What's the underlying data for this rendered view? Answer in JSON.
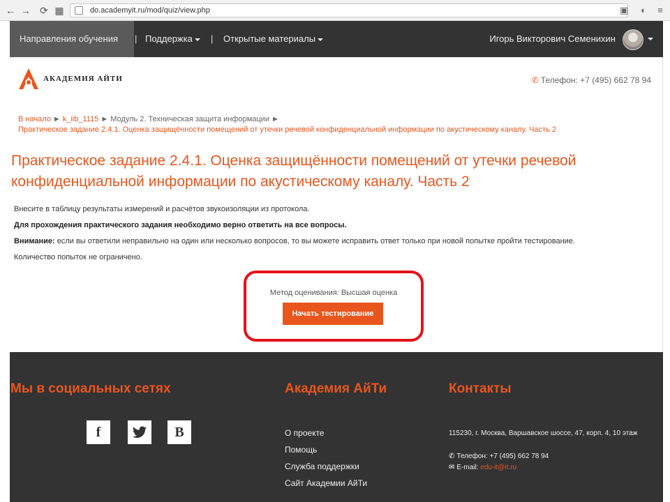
{
  "browser": {
    "url": "do.academyit.ru/mod/quiz/view.php"
  },
  "topnav": {
    "items": [
      {
        "label": "Направления обучения"
      },
      {
        "label": "Поддержка"
      },
      {
        "label": "Открытые материалы"
      }
    ],
    "separator": "|",
    "user_name": "Игорь Викторович Семенихин"
  },
  "brand": {
    "logo_text": "АКАДЕМИЯ АЙТИ",
    "phone_label": "Телефон:",
    "phone_number": "+7 (495) 662 78 94",
    "accent_color": "#e8561e"
  },
  "breadcrumb": {
    "items": [
      "В начало",
      "k_iib_1115",
      "Модуль 2. Техническая защита информации"
    ],
    "current": "Практическое задание 2.4.1. Оценка защищённости помещений от утечки речевой конфиденциальной информации по акустическому каналу. Часть 2"
  },
  "page": {
    "title": "Практическое задание 2.4.1. Оценка защищённости помещений от утечки речевой конфиденциальной информации по акустическому каналу. Часть 2",
    "intro_1": "Внесите в таблицу результаты измерений и расчётов звукоизоляции из протокола.",
    "intro_2": "Для прохождения практического задания необходимо верно ответить на все вопросы.",
    "intro_3_bold": "Внимание:",
    "intro_3_text": " если вы ответили неправильно на один или несколько вопросов, то вы можете исправить ответ только при новой попытке пройти тестирование.",
    "intro_4": "Количество попыток не ограничено.",
    "grading_method": "Метод оценивания: Высшая оценка",
    "start_button": "Начать тестирование"
  },
  "footer": {
    "social_heading": "Мы в социальных сетях",
    "social_icons": [
      "f",
      "twitter-bird",
      "B"
    ],
    "academy_heading": "Академия АйТи",
    "academy_links": [
      "О проекте",
      "Помощь",
      "Служба поддержки",
      "Сайт Академии АйТи"
    ],
    "contacts_heading": "Контакты",
    "address": "115230, г. Москва, Варшавское шоссе, 47, корп. 4, 10 этаж",
    "phone_label": "Телефон:",
    "phone_number": "+7 (495) 662 78 94",
    "email_label": "E-mail:",
    "email": "edu-it@it.ru"
  }
}
